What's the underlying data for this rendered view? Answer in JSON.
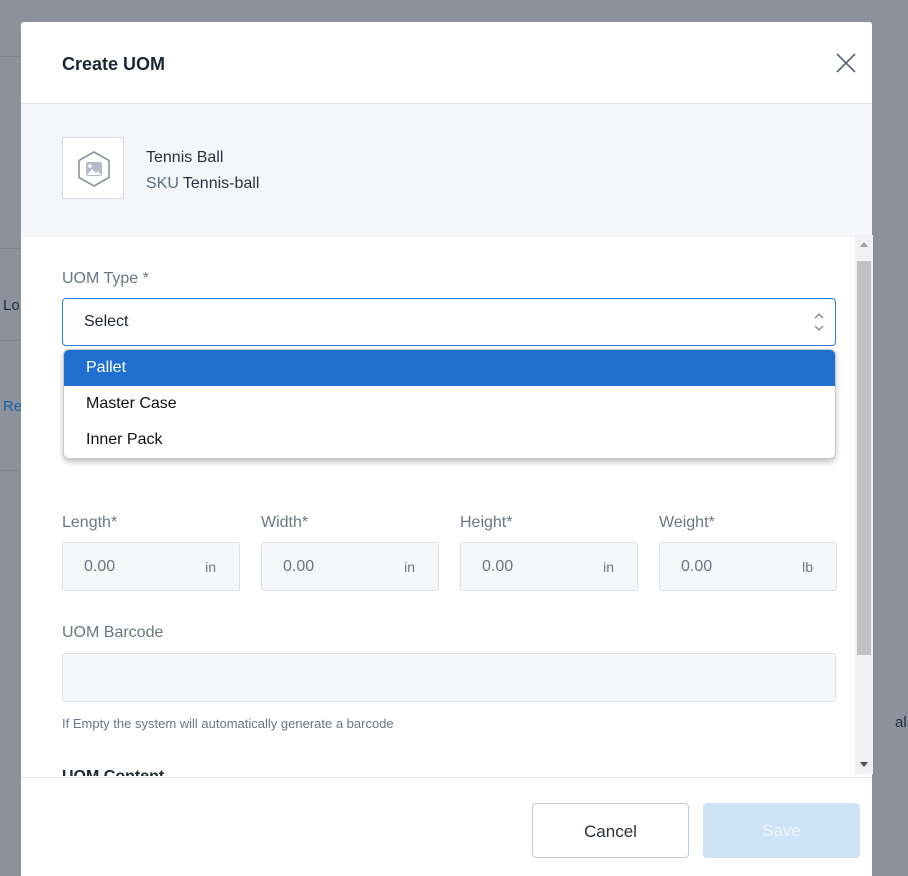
{
  "modal": {
    "title": "Create UOM"
  },
  "product": {
    "name": "Tennis Ball",
    "sku_label": "SKU",
    "sku_value": "Tennis-ball"
  },
  "uom_type": {
    "label": "UOM Type *",
    "value": "Select",
    "options": [
      "Pallet",
      "Master Case",
      "Inner Pack"
    ],
    "highlighted": "Pallet"
  },
  "dimensions": [
    {
      "label": "Length*",
      "value": "0.00",
      "unit": "in"
    },
    {
      "label": "Width*",
      "value": "0.00",
      "unit": "in"
    },
    {
      "label": "Height*",
      "value": "0.00",
      "unit": "in"
    },
    {
      "label": "Weight*",
      "value": "0.00",
      "unit": "lb"
    }
  ],
  "barcode": {
    "label": "UOM Barcode",
    "value": "",
    "hint": "If Empty the system will automatically generate a barcode"
  },
  "content": {
    "label": "UOM Content"
  },
  "footer": {
    "cancel_label": "Cancel",
    "save_label": "Save"
  },
  "background": {
    "fragment_lo": "Lo",
    "fragment_re": "Re",
    "fragment_al": "al"
  },
  "colors": {
    "accent": "#1f6fd1",
    "save_disabled": "#cfe3f7",
    "overlay": "#8c929b"
  }
}
